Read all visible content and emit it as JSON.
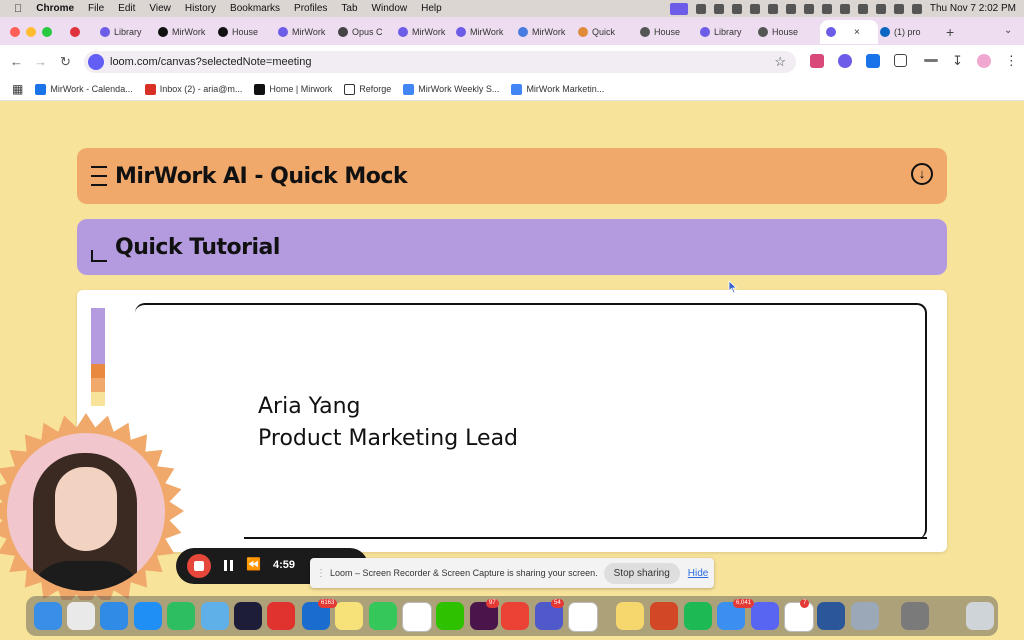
{
  "menubar": {
    "app": "Chrome",
    "items": [
      "File",
      "Edit",
      "View",
      "History",
      "Bookmarks",
      "Profiles",
      "Tab",
      "Window",
      "Help"
    ],
    "datetime": "Thu Nov 7  2:02 PM"
  },
  "tabs": [
    {
      "label": "",
      "color": "#e0323c"
    },
    {
      "label": "Library",
      "color": "#6c5ce7"
    },
    {
      "label": "MirWork",
      "color": "#111111"
    },
    {
      "label": "House",
      "color": "#111111"
    },
    {
      "label": "MirWork",
      "color": "#6c5ce7"
    },
    {
      "label": "Opus C",
      "color": "#444444"
    },
    {
      "label": "MirWork",
      "color": "#6c5ce7"
    },
    {
      "label": "MirWork",
      "color": "#6c5ce7"
    },
    {
      "label": "MirWork",
      "color": "#4a7be0"
    },
    {
      "label": "Quick",
      "color": "#e08a3c"
    },
    {
      "label": "House",
      "color": "#555555"
    },
    {
      "label": "Library",
      "color": "#6c5ce7"
    },
    {
      "label": "House",
      "color": "#555555"
    },
    {
      "label": "",
      "color": "#6c5ce7",
      "active": true
    },
    {
      "label": "(1) pro",
      "color": "#0a66c2"
    }
  ],
  "address": {
    "url": "loom.com/canvas?selectedNote=meeting"
  },
  "bookmarks": [
    {
      "label": "MirWork - Calenda...",
      "color": "#1a73e8"
    },
    {
      "label": "Inbox (2) - aria@m...",
      "color": "#d93025"
    },
    {
      "label": "Home | Mirwork",
      "color": "#111111"
    },
    {
      "label": "Reforge",
      "color": "#333333"
    },
    {
      "label": "MirWork Weekly S...",
      "color": "#4285f4"
    },
    {
      "label": "MirWork Marketin...",
      "color": "#4285f4"
    }
  ],
  "page": {
    "title": "MirWork AI - Quick Mock",
    "subtitle": "Quick Tutorial",
    "presenter_name": "Aria Yang",
    "presenter_role": "Product Marketing Lead",
    "colors": {
      "background": "#f8e39a",
      "title_bar": "#f0a96b",
      "subtitle_bar": "#b49be0"
    }
  },
  "loom": {
    "timer": "4:59",
    "sharing_text": "Loom – Screen Recorder & Screen Capture is sharing your screen.",
    "stop_label": "Stop sharing",
    "hide_label": "Hide"
  },
  "dock": {
    "badges": [
      "6163",
      "97",
      "54",
      "6,041",
      "7"
    ]
  }
}
